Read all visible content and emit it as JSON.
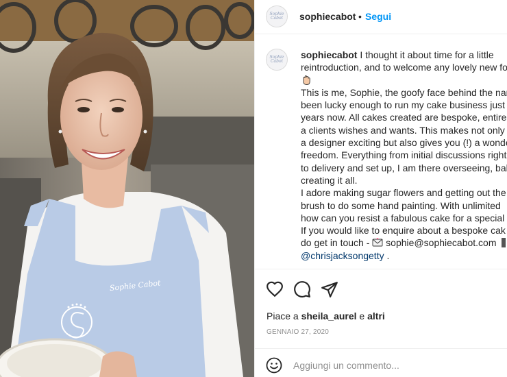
{
  "post": {
    "username": "sophiecabot",
    "separator": "•",
    "follow_label": "Segui",
    "avatar_text": "Sophie Cabot"
  },
  "caption": {
    "username": "sophiecabot",
    "line1": " I thought it about time for a little",
    "line2": "reintroduction, and to welcome any lovely new fo",
    "line3": "This is me, Sophie, the goofy face behind the nar",
    "line4": "been lucky enough to run my cake business just",
    "line5": "years now. All cakes created are bespoke, entirely",
    "line6": "a clients wishes and wants. This makes not only r",
    "line7": "a designer exciting but also gives you (!) a wonde",
    "line8": "freedom. Everything from initial discussions right",
    "line9": "to delivery and set up, I am there overseeing, bal",
    "line10": "creating it all.",
    "line11": "I adore making sugar flowers and getting out the",
    "line12": "brush to do some hand painting. With unlimited",
    "line13": "how can you resist a fabulous cake for a special c",
    "line14": "If you would like to enquire about a bespoke cak",
    "line15_prefix": "do get in touch - ",
    "email": " sophie@sophiecabot.com ",
    "mention": "@chrisjacksongetty",
    "mention_suffix": " ."
  },
  "icons": {
    "like": "heart-icon",
    "comment": "comment-bubble-icon",
    "share": "paper-plane-icon",
    "emoji": "smiley-icon",
    "mail": "envelope-icon",
    "hand": "waving-hand-icon"
  },
  "likes": {
    "prefix": "Piace a ",
    "user": "sheila_aurel",
    "conj": " e ",
    "others": "altri"
  },
  "date": "GENNAIO 27, 2020",
  "comment_box": {
    "placeholder": "Aggiungi un commento..."
  },
  "colors": {
    "accent": "#0095f6",
    "mention": "#00376b",
    "muted": "#8e8e8e",
    "apron": "#b9cbe6"
  },
  "photo": {
    "apron_logo_text": "Sophie Cabot"
  }
}
